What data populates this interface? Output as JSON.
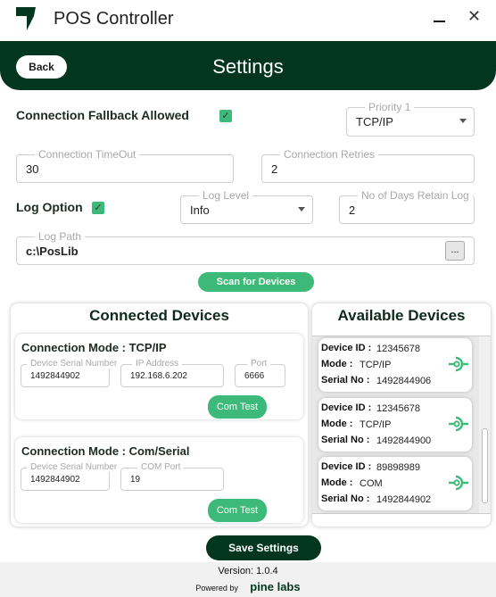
{
  "window": {
    "title": "POS Controller",
    "minimize_icon": "minimize-icon",
    "close_icon": "close-icon"
  },
  "header": {
    "back_label": "Back",
    "title": "Settings"
  },
  "colors": {
    "brand_dark": "#02361f",
    "accent_green": "#3dba79"
  },
  "settings": {
    "fallback_label": "Connection Fallback Allowed",
    "fallback_checked": true,
    "priority": {
      "legend": "Priority 1",
      "value": "TCP/IP"
    },
    "timeout": {
      "legend": "Connection TimeOut",
      "value": "30"
    },
    "retries": {
      "legend": "Connection Retries",
      "value": "2"
    },
    "log_option_label": "Log Option",
    "log_option_checked": true,
    "log_level": {
      "legend": "Log Level",
      "value": "Info"
    },
    "retain_days": {
      "legend": "No of Days Retain Log",
      "value": "2"
    },
    "log_path": {
      "legend": "Log Path",
      "value": "c:\\PosLib",
      "browse_label": "..."
    },
    "scan_label": "Scan for Devices"
  },
  "connected": {
    "title": "Connected Devices",
    "cards": [
      {
        "mode": "Connection Mode : TCP/IP",
        "serial_legend": "Device Serial Number",
        "serial": "1492844902",
        "ip_legend": "IP Address",
        "ip": "192.168.6.202",
        "port_legend": "Port",
        "port": "6666",
        "test_label": "Com Test"
      },
      {
        "mode": "Connection Mode : Com/Serial",
        "serial_legend": "Device Serial Number",
        "serial": "1492844902",
        "com_legend": "COM Port",
        "com": "19",
        "test_label": "Com Test"
      }
    ]
  },
  "available": {
    "title": "Available Devices",
    "id_label": "Device ID :",
    "mode_label": "Mode :",
    "serial_label": "Serial No :",
    "devices": [
      {
        "id": "12345678",
        "mode": "TCP/IP",
        "serial": "1492844906"
      },
      {
        "id": "12345678",
        "mode": "TCP/IP",
        "serial": "1492844900"
      },
      {
        "id": "89898989",
        "mode": "COM",
        "serial": "1492844902"
      }
    ]
  },
  "save_label": "Save Settings",
  "footer": {
    "version_label": "Version:",
    "version": "1.0.4",
    "powered_by": "Powered by",
    "brand": "pine labs"
  }
}
